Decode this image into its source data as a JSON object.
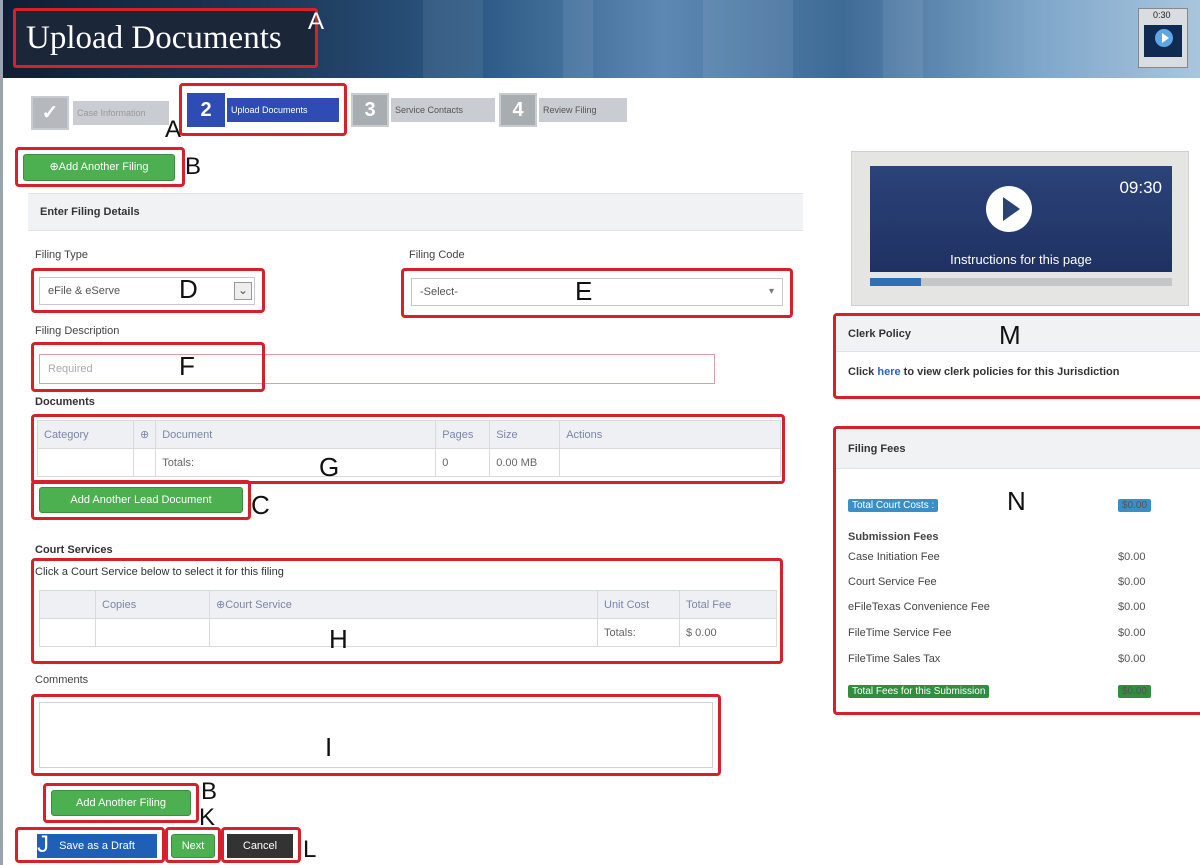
{
  "header": {
    "title": "Upload Documents",
    "marker": "A",
    "timer": "0:30"
  },
  "steps": [
    {
      "label": "Case Information",
      "number": "✓",
      "state": "done"
    },
    {
      "label": "Upload Documents",
      "number": "2",
      "state": "active"
    },
    {
      "label": "Service Contacts",
      "number": "3",
      "state": "upcoming"
    },
    {
      "label": "Review Filing",
      "number": "4",
      "state": "upcoming"
    }
  ],
  "markers": {
    "steps": "A",
    "add_filing_top": "B",
    "add_lead_doc": "C",
    "filing_type": "D",
    "filing_code": "E",
    "description": "F",
    "documents": "G",
    "court_services": "H",
    "comments": "I",
    "save_draft": "J",
    "next": "K",
    "cancel": "L",
    "clerk_policy": "M",
    "filing_fees": "N",
    "add_filing_bottom": "B"
  },
  "actions": {
    "add_filing_top": "⊕Add Another Filing",
    "add_filing_bottom": "Add Another Filing",
    "add_lead_doc": "Add Another Lead Document",
    "save_draft": "Save as a Draft",
    "next": "Next",
    "cancel": "Cancel"
  },
  "form": {
    "section_title": "Enter Filing Details",
    "filing_type_label": "Filing Type",
    "filing_type_value": "eFile & eServe",
    "filing_code_label": "Filing Code",
    "filing_code_value": "-Select-",
    "description_label": "Filing Description",
    "description_placeholder": "Required"
  },
  "documents": {
    "title": "Documents",
    "columns": [
      "Category",
      "Document",
      "Pages",
      "Size",
      "Actions"
    ],
    "totals_label": "Totals:",
    "totals_pages": "0",
    "totals_size": "0.00 MB"
  },
  "court_services": {
    "title": "Court Services",
    "instruction": "Click a Court Service below to select it for this filing",
    "columns": [
      "",
      "Copies",
      "Court Service",
      "Unit Cost",
      "Total Fee"
    ],
    "totals_label": "Totals:",
    "totals_fee": "$ 0.00"
  },
  "comments": {
    "title": "Comments"
  },
  "video": {
    "time": "09:30",
    "caption": "Instructions for this page",
    "progress": 0.17
  },
  "clerk_policy": {
    "title": "Clerk Policy",
    "text_before": "Click ",
    "link": "here",
    "text_after": " to view clerk policies for this Jurisdiction"
  },
  "filing_fees": {
    "title": "Filing Fees",
    "total_court_label": "Total Court Costs :",
    "total_court_value": "$0.00",
    "submission_title": "Submission Fees",
    "items": [
      {
        "label": "Case Initiation Fee",
        "amount": "$0.00"
      },
      {
        "label": "Court Service Fee",
        "amount": "$0.00"
      },
      {
        "label": "eFileTexas Convenience Fee",
        "amount": "$0.00"
      },
      {
        "label": "FileTime Service Fee",
        "amount": "$0.00"
      },
      {
        "label": "FileTime Sales Tax",
        "amount": "$0.00"
      }
    ],
    "total_label": "Total Fees for this Submission",
    "total_value": "$0.00"
  },
  "colors": {
    "annotation_red": "#d6202a",
    "accent_green": "#4caf50",
    "accent_blue": "#2f4cb4"
  }
}
